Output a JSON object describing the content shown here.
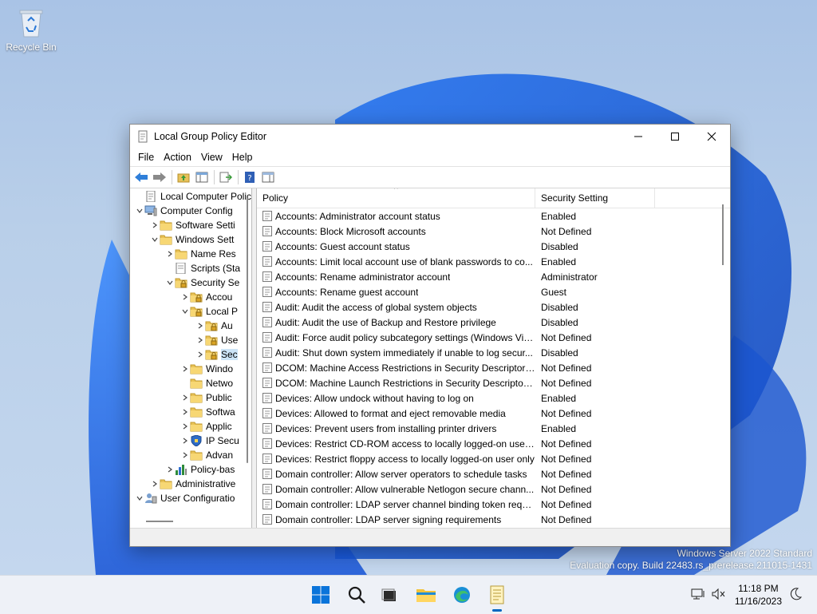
{
  "desktop": {
    "recycle_bin_label": "Recycle Bin",
    "watermark_line1": "Windows Server 2022 Standard",
    "watermark_line2": "Evaluation copy. Build 22483.rs_prerelease.211015-1431"
  },
  "window": {
    "title": "Local Group Policy Editor",
    "menu": [
      "File",
      "Action",
      "View",
      "Help"
    ]
  },
  "tree": [
    {
      "label": "Local Computer Polic",
      "indent": 0,
      "chev": "",
      "icon": "policy-icon"
    },
    {
      "label": "Computer Config",
      "indent": 0,
      "chev": "down",
      "icon": "computer-icon"
    },
    {
      "label": "Software Setti",
      "indent": 1,
      "chev": "right",
      "icon": "folder-icon"
    },
    {
      "label": "Windows Sett",
      "indent": 1,
      "chev": "down",
      "icon": "folder-icon"
    },
    {
      "label": "Name Res",
      "indent": 2,
      "chev": "right",
      "icon": "folder-icon"
    },
    {
      "label": "Scripts (Sta",
      "indent": 2,
      "chev": "",
      "icon": "script-icon"
    },
    {
      "label": "Security Se",
      "indent": 2,
      "chev": "down",
      "icon": "security-folder-icon"
    },
    {
      "label": "Accou",
      "indent": 3,
      "chev": "right",
      "icon": "security-folder-icon"
    },
    {
      "label": "Local P",
      "indent": 3,
      "chev": "down",
      "icon": "security-folder-icon"
    },
    {
      "label": "Au",
      "indent": 4,
      "chev": "right",
      "icon": "security-folder-icon"
    },
    {
      "label": "Use",
      "indent": 4,
      "chev": "right",
      "icon": "security-folder-icon"
    },
    {
      "label": "Sec",
      "indent": 4,
      "chev": "right",
      "icon": "security-folder-icon",
      "selected": true
    },
    {
      "label": "Windo",
      "indent": 3,
      "chev": "right",
      "icon": "folder-icon"
    },
    {
      "label": "Netwo",
      "indent": 3,
      "chev": "",
      "icon": "folder-icon"
    },
    {
      "label": "Public",
      "indent": 3,
      "chev": "right",
      "icon": "folder-icon"
    },
    {
      "label": "Softwa",
      "indent": 3,
      "chev": "right",
      "icon": "folder-icon"
    },
    {
      "label": "Applic",
      "indent": 3,
      "chev": "right",
      "icon": "folder-icon"
    },
    {
      "label": "IP Secu",
      "indent": 3,
      "chev": "right",
      "icon": "shield-icon"
    },
    {
      "label": "Advan",
      "indent": 3,
      "chev": "right",
      "icon": "folder-icon"
    },
    {
      "label": "Policy-bas",
      "indent": 2,
      "chev": "right",
      "icon": "chart-icon"
    },
    {
      "label": "Administrative",
      "indent": 1,
      "chev": "right",
      "icon": "folder-icon"
    },
    {
      "label": "User Configuratio",
      "indent": 0,
      "chev": "down",
      "icon": "user-icon"
    }
  ],
  "list": {
    "col_policy": "Policy",
    "col_setting": "Security Setting",
    "rows": [
      {
        "policy": "Accounts: Administrator account status",
        "setting": "Enabled"
      },
      {
        "policy": "Accounts: Block Microsoft accounts",
        "setting": "Not Defined"
      },
      {
        "policy": "Accounts: Guest account status",
        "setting": "Disabled"
      },
      {
        "policy": "Accounts: Limit local account use of blank passwords to co...",
        "setting": "Enabled"
      },
      {
        "policy": "Accounts: Rename administrator account",
        "setting": "Administrator"
      },
      {
        "policy": "Accounts: Rename guest account",
        "setting": "Guest"
      },
      {
        "policy": "Audit: Audit the access of global system objects",
        "setting": "Disabled"
      },
      {
        "policy": "Audit: Audit the use of Backup and Restore privilege",
        "setting": "Disabled"
      },
      {
        "policy": "Audit: Force audit policy subcategory settings (Windows Vis...",
        "setting": "Not Defined"
      },
      {
        "policy": "Audit: Shut down system immediately if unable to log secur...",
        "setting": "Disabled"
      },
      {
        "policy": "DCOM: Machine Access Restrictions in Security Descriptor D...",
        "setting": "Not Defined"
      },
      {
        "policy": "DCOM: Machine Launch Restrictions in Security Descriptor ...",
        "setting": "Not Defined"
      },
      {
        "policy": "Devices: Allow undock without having to log on",
        "setting": "Enabled"
      },
      {
        "policy": "Devices: Allowed to format and eject removable media",
        "setting": "Not Defined"
      },
      {
        "policy": "Devices: Prevent users from installing printer drivers",
        "setting": "Enabled"
      },
      {
        "policy": "Devices: Restrict CD-ROM access to locally logged-on user ...",
        "setting": "Not Defined"
      },
      {
        "policy": "Devices: Restrict floppy access to locally logged-on user only",
        "setting": "Not Defined"
      },
      {
        "policy": "Domain controller: Allow server operators to schedule tasks",
        "setting": "Not Defined"
      },
      {
        "policy": "Domain controller: Allow vulnerable Netlogon secure chann...",
        "setting": "Not Defined"
      },
      {
        "policy": "Domain controller: LDAP server channel binding token requi...",
        "setting": "Not Defined"
      },
      {
        "policy": "Domain controller: LDAP server signing requirements",
        "setting": "Not Defined"
      }
    ]
  },
  "taskbar": {
    "time": "11:18 PM",
    "date": "11/16/2023"
  }
}
